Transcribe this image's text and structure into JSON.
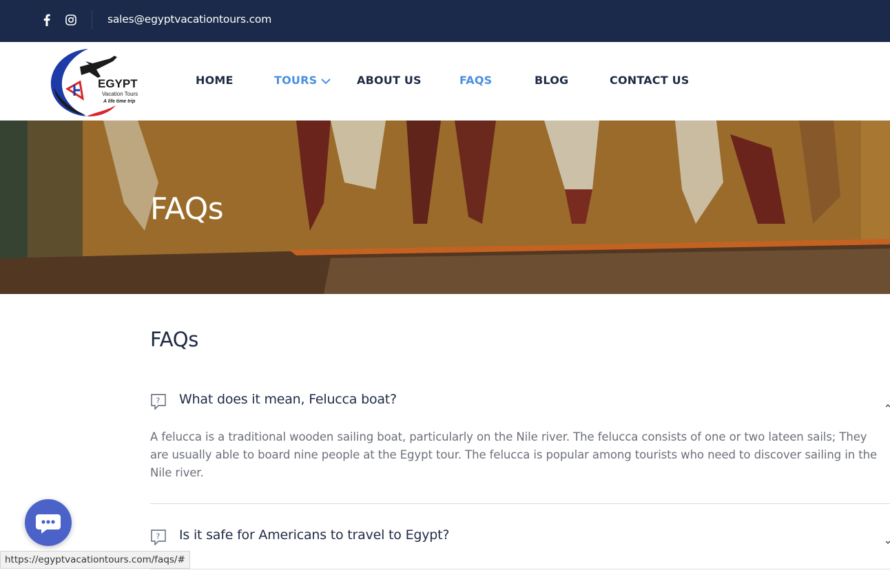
{
  "topbar": {
    "email": "sales@egyptvacationtours.com",
    "social": [
      "facebook-icon",
      "instagram-icon"
    ],
    "background": "#1b2a4a"
  },
  "logo": {
    "brand": "EGYPT",
    "line2": "Vacation Tours",
    "line3": "A life time trip"
  },
  "nav": {
    "items": [
      {
        "label": "HOME",
        "active": false
      },
      {
        "label": "TOURS",
        "active": true,
        "has_dropdown": true
      },
      {
        "label": "ABOUT US",
        "active": false
      },
      {
        "label": "FAQS",
        "active": true
      },
      {
        "label": "BLOG",
        "active": false
      },
      {
        "label": "CONTACT US",
        "active": false
      }
    ],
    "accent": "#4a8fe0"
  },
  "hero": {
    "title": "FAQs"
  },
  "main": {
    "title": "FAQs",
    "faqs": [
      {
        "question": "What does it mean, Felucca boat?",
        "answer": "A felucca is a traditional wooden sailing boat, particularly on the Nile river. The felucca consists of one or two lateen sails; They are usually able to board nine people at the Egypt tour. The felucca is popular among tourists who need to discover sailing in the Nile river.",
        "expanded": true
      },
      {
        "question": "Is it safe for Americans to travel to Egypt?",
        "expanded": false
      }
    ]
  },
  "chat": {
    "icon": "chat-bubble-icon",
    "color": "#4b63c9"
  },
  "status_bar": {
    "url": "https://egyptvacationtours.com/faqs/#"
  }
}
